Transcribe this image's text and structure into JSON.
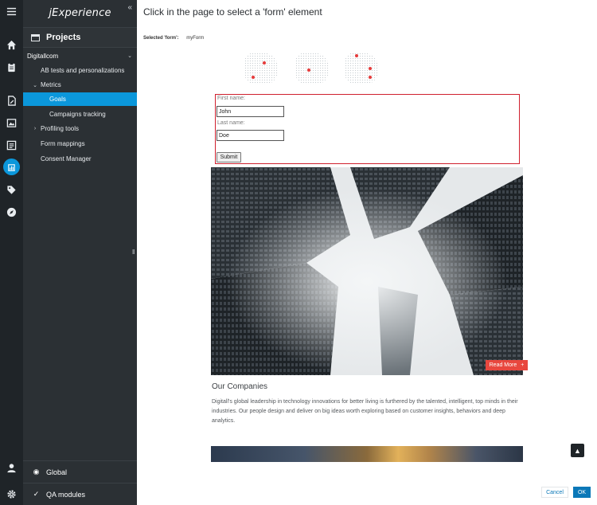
{
  "sidebar": {
    "brand": "jExperience",
    "projects_label": "Projects",
    "site": "Digitallcom",
    "items": [
      {
        "label": "AB tests and personalizations"
      },
      {
        "label": "Metrics"
      },
      {
        "label": "Goals"
      },
      {
        "label": "Campaigns tracking"
      },
      {
        "label": "Profiling tools"
      },
      {
        "label": "Form mappings"
      },
      {
        "label": "Consent Manager"
      }
    ],
    "bottom": [
      {
        "label": "Global"
      },
      {
        "label": "QA modules"
      }
    ]
  },
  "main": {
    "title": "Click in the page to select a 'form' element",
    "selected_label": "Selected 'form':",
    "selected_value": "myForm",
    "form": {
      "first_name_label": "First name:",
      "first_name_value": "John",
      "last_name_label": "Last name:",
      "last_name_value": "Doe",
      "submit_label": "Submit"
    },
    "read_more": "Read More",
    "read_more_plus": "+",
    "section_title": "Our Companies",
    "section_text": "Digitall's global leadership in technology innovations for better living is furthered by the talented, intelligent, top minds in their industries. Our people design and deliver on big ideas worth exploring based on customer insights, behaviors and deep analytics."
  },
  "footer": {
    "cancel": "Cancel",
    "ok": "OK"
  },
  "colors": {
    "rail": "#1f2428",
    "sidebar": "#2b3034",
    "accent": "#0b97db",
    "form_border": "#d0202e",
    "read_more": "#e8473e"
  }
}
